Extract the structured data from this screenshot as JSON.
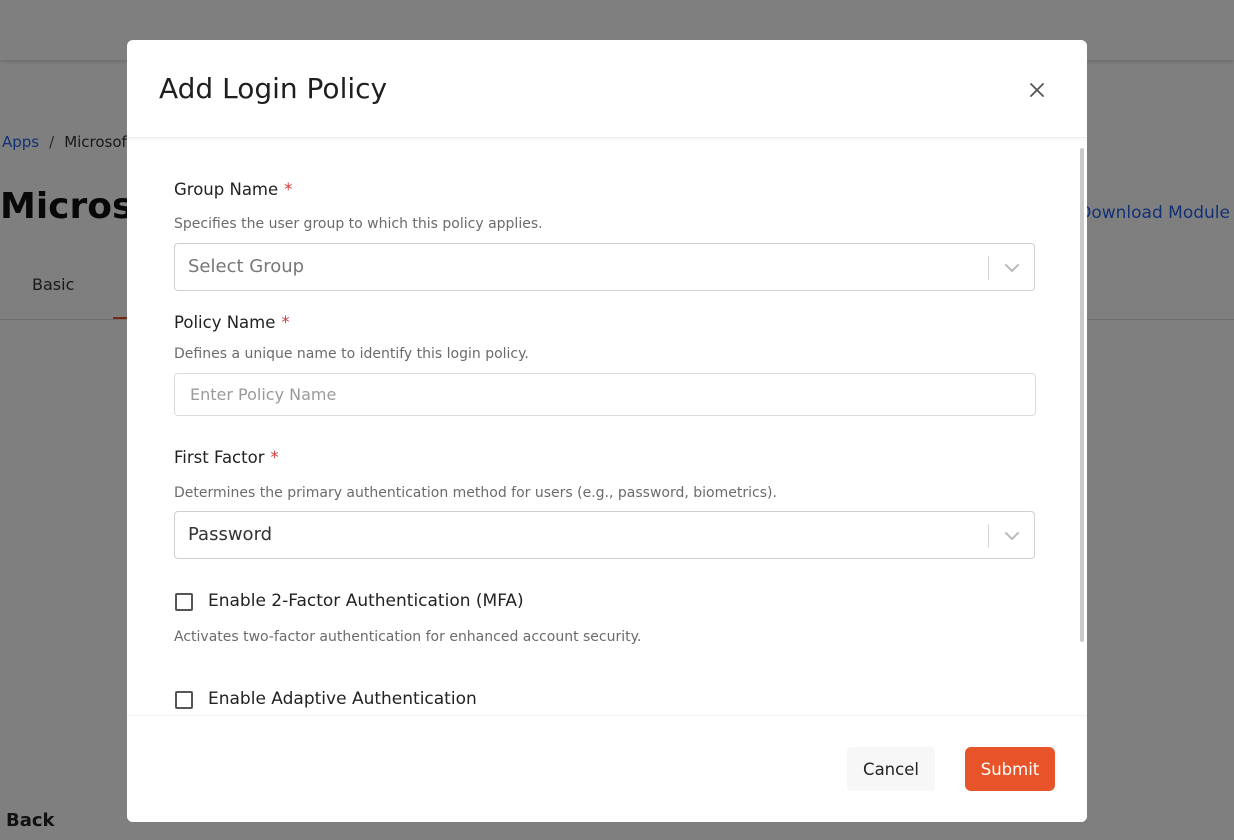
{
  "background": {
    "breadcrumb": {
      "apps": "Apps",
      "separator": "/",
      "current": "Microsof"
    },
    "page_title": "Microso",
    "download_link": "Download Module",
    "tab_basic": "Basic",
    "back_label": "Back"
  },
  "modal": {
    "title": "Add Login Policy",
    "close_icon": "close-icon",
    "group_name": {
      "label": "Group Name",
      "required_mark": "*",
      "description": "Specifies the user group to which this policy applies.",
      "placeholder": "Select Group"
    },
    "policy_name": {
      "label": "Policy Name",
      "required_mark": "*",
      "description": "Defines a unique name to identify this login policy.",
      "placeholder": "Enter Policy Name",
      "value": ""
    },
    "first_factor": {
      "label": "First Factor",
      "required_mark": "*",
      "description": "Determines the primary authentication method for users (e.g., password, biometrics).",
      "selected": "Password"
    },
    "mfa": {
      "label": "Enable 2-Factor Authentication (MFA)",
      "description": "Activates two-factor authentication for enhanced account security.",
      "checked": false
    },
    "adaptive": {
      "label": "Enable Adaptive Authentication",
      "checked": false
    },
    "footer": {
      "cancel_label": "Cancel",
      "submit_label": "Submit"
    }
  },
  "colors": {
    "accent": "#e8542a",
    "link": "#2563eb",
    "required": "#d63a3a"
  }
}
